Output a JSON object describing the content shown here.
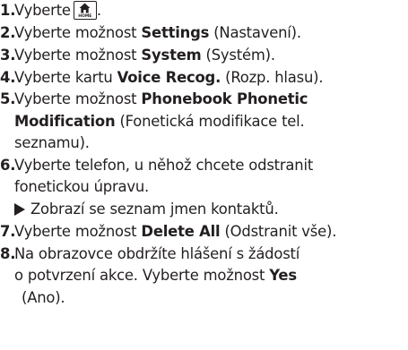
{
  "steps": [
    {
      "num": "1.",
      "pre": "Vyberte",
      "button_label": "HOME",
      "post": "."
    },
    {
      "num": "2.",
      "pre": "Vyberte možnost ",
      "bold": "Settings",
      "post": " (Nastavení)."
    },
    {
      "num": "3.",
      "pre": "Vyberte možnost ",
      "bold": "System",
      "post": " (Systém)."
    },
    {
      "num": "4.",
      "pre": "Vyberte kartu ",
      "bold": "Voice Recog.",
      "post": " (Rozp. hlasu)."
    },
    {
      "num": "5.",
      "pre": "Vyberte možnost ",
      "bold_line1": "Phonebook Phonetic",
      "bold_line2": "Modification",
      "post_line2": " (Fonetická modifikace tel.",
      "line3": "seznamu)."
    },
    {
      "num": "6.",
      "line1": "Vyberte telefon, u něhož chcete odstranit",
      "line2": "fonetickou úpravu.",
      "result": "Zobrazí se seznam jmen kontaktů."
    },
    {
      "num": "7.",
      "pre": "Vyberte možnost ",
      "bold": "Delete All",
      "post": " (Odstranit vše)."
    },
    {
      "num": "8.",
      "line1": "Na obrazovce obdržíte hlášení s žádostí",
      "line2_pre": "o potvrzení akce. Vyberte možnost ",
      "line2_bold": "Yes",
      "line3": "(Ano)."
    }
  ]
}
